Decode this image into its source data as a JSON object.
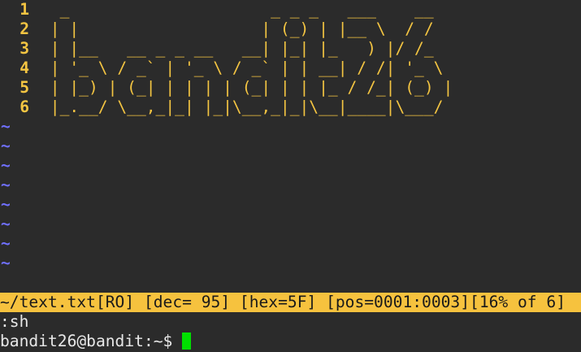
{
  "editor": {
    "lines": [
      {
        "number": "1",
        "text": "  _                     _ _ _   ___    __ "
      },
      {
        "number": "2",
        "text": " | |                   | (_) | |__ \\  / / "
      },
      {
        "number": "3",
        "text": " | |__   __ _ _ __   __| |_| |_   ) |/ /_ "
      },
      {
        "number": "4",
        "text": " | '_ \\ / _` | '_ \\ / _` | | __| / /| '_ \\"
      },
      {
        "number": "5",
        "text": " | |_) | (_| | | | | (_| | | |_ / /_| (_) |"
      },
      {
        "number": "6",
        "text": " |_.__/ \\__,_|_| |_|\\__,_|_|\\__|____|\\___/ "
      }
    ],
    "tildes": [
      "~",
      "~",
      "~",
      "~",
      "~",
      "~",
      "~",
      "~"
    ],
    "colors": {
      "text": "#f4c542",
      "tilde": "#7070ff",
      "background": "#2b2b2b",
      "status_bg": "#f6c23e"
    }
  },
  "statusline": {
    "text": "~/text.txt[RO] [dec= 95] [hex=5F] [pos=0001:0003][16% of 6]"
  },
  "commandline": {
    "text": ":sh"
  },
  "shell": {
    "prompt": "bandit26@bandit:~$",
    "cursor_color": "#00e000"
  }
}
